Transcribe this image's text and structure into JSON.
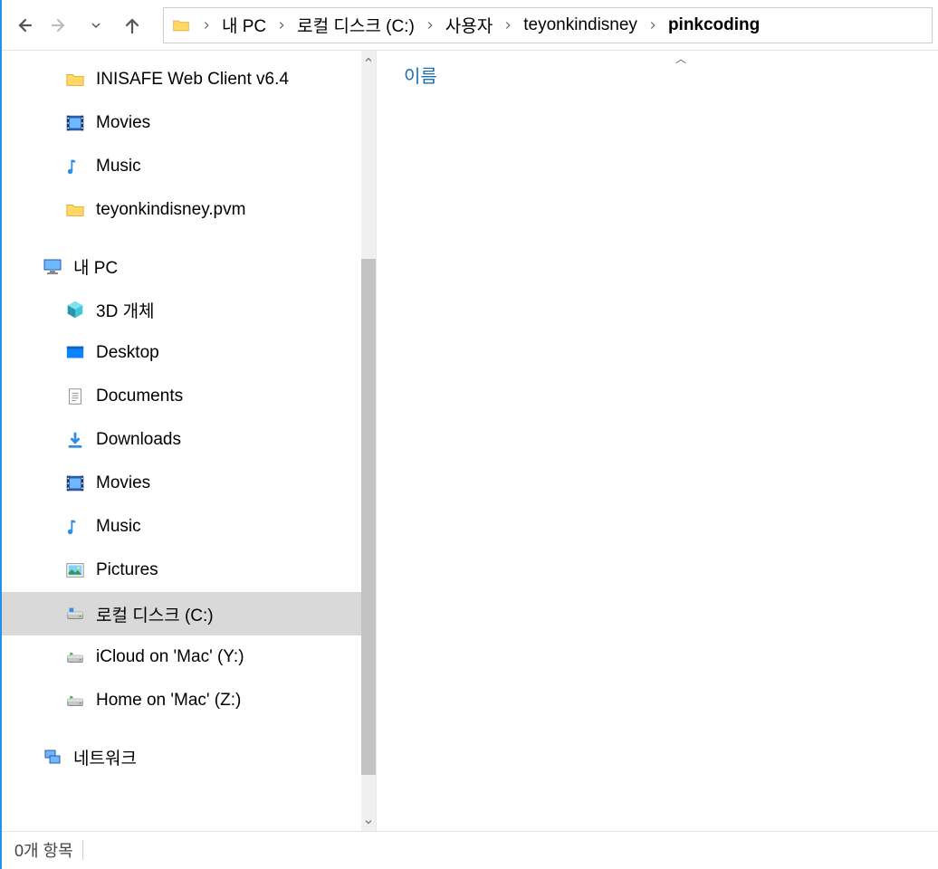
{
  "breadcrumbs": [
    "내 PC",
    "로컬 디스크 (C:)",
    "사용자",
    "teyonkindisney",
    "pinkcoding"
  ],
  "column_header": "이름",
  "status": "0개 항목",
  "tree": {
    "items_top": [
      {
        "icon": "folder",
        "label": "INISAFE Web Client v6.4"
      },
      {
        "icon": "video",
        "label": "Movies"
      },
      {
        "icon": "music",
        "label": "Music"
      },
      {
        "icon": "folder",
        "label": "teyonkindisney.pvm"
      }
    ],
    "pc_label": "내 PC",
    "pc_children": [
      {
        "icon": "cube",
        "label": "3D 개체"
      },
      {
        "icon": "desktop",
        "label": "Desktop"
      },
      {
        "icon": "doc",
        "label": "Documents"
      },
      {
        "icon": "download",
        "label": "Downloads"
      },
      {
        "icon": "video",
        "label": "Movies"
      },
      {
        "icon": "music",
        "label": "Music"
      },
      {
        "icon": "picture",
        "label": "Pictures"
      },
      {
        "icon": "disk",
        "label": "로컬 디스크 (C:)",
        "selected": true
      },
      {
        "icon": "netdrive",
        "label": "iCloud on 'Mac' (Y:)"
      },
      {
        "icon": "netdrive",
        "label": "Home on 'Mac' (Z:)"
      }
    ],
    "network_label": "네트워크"
  }
}
